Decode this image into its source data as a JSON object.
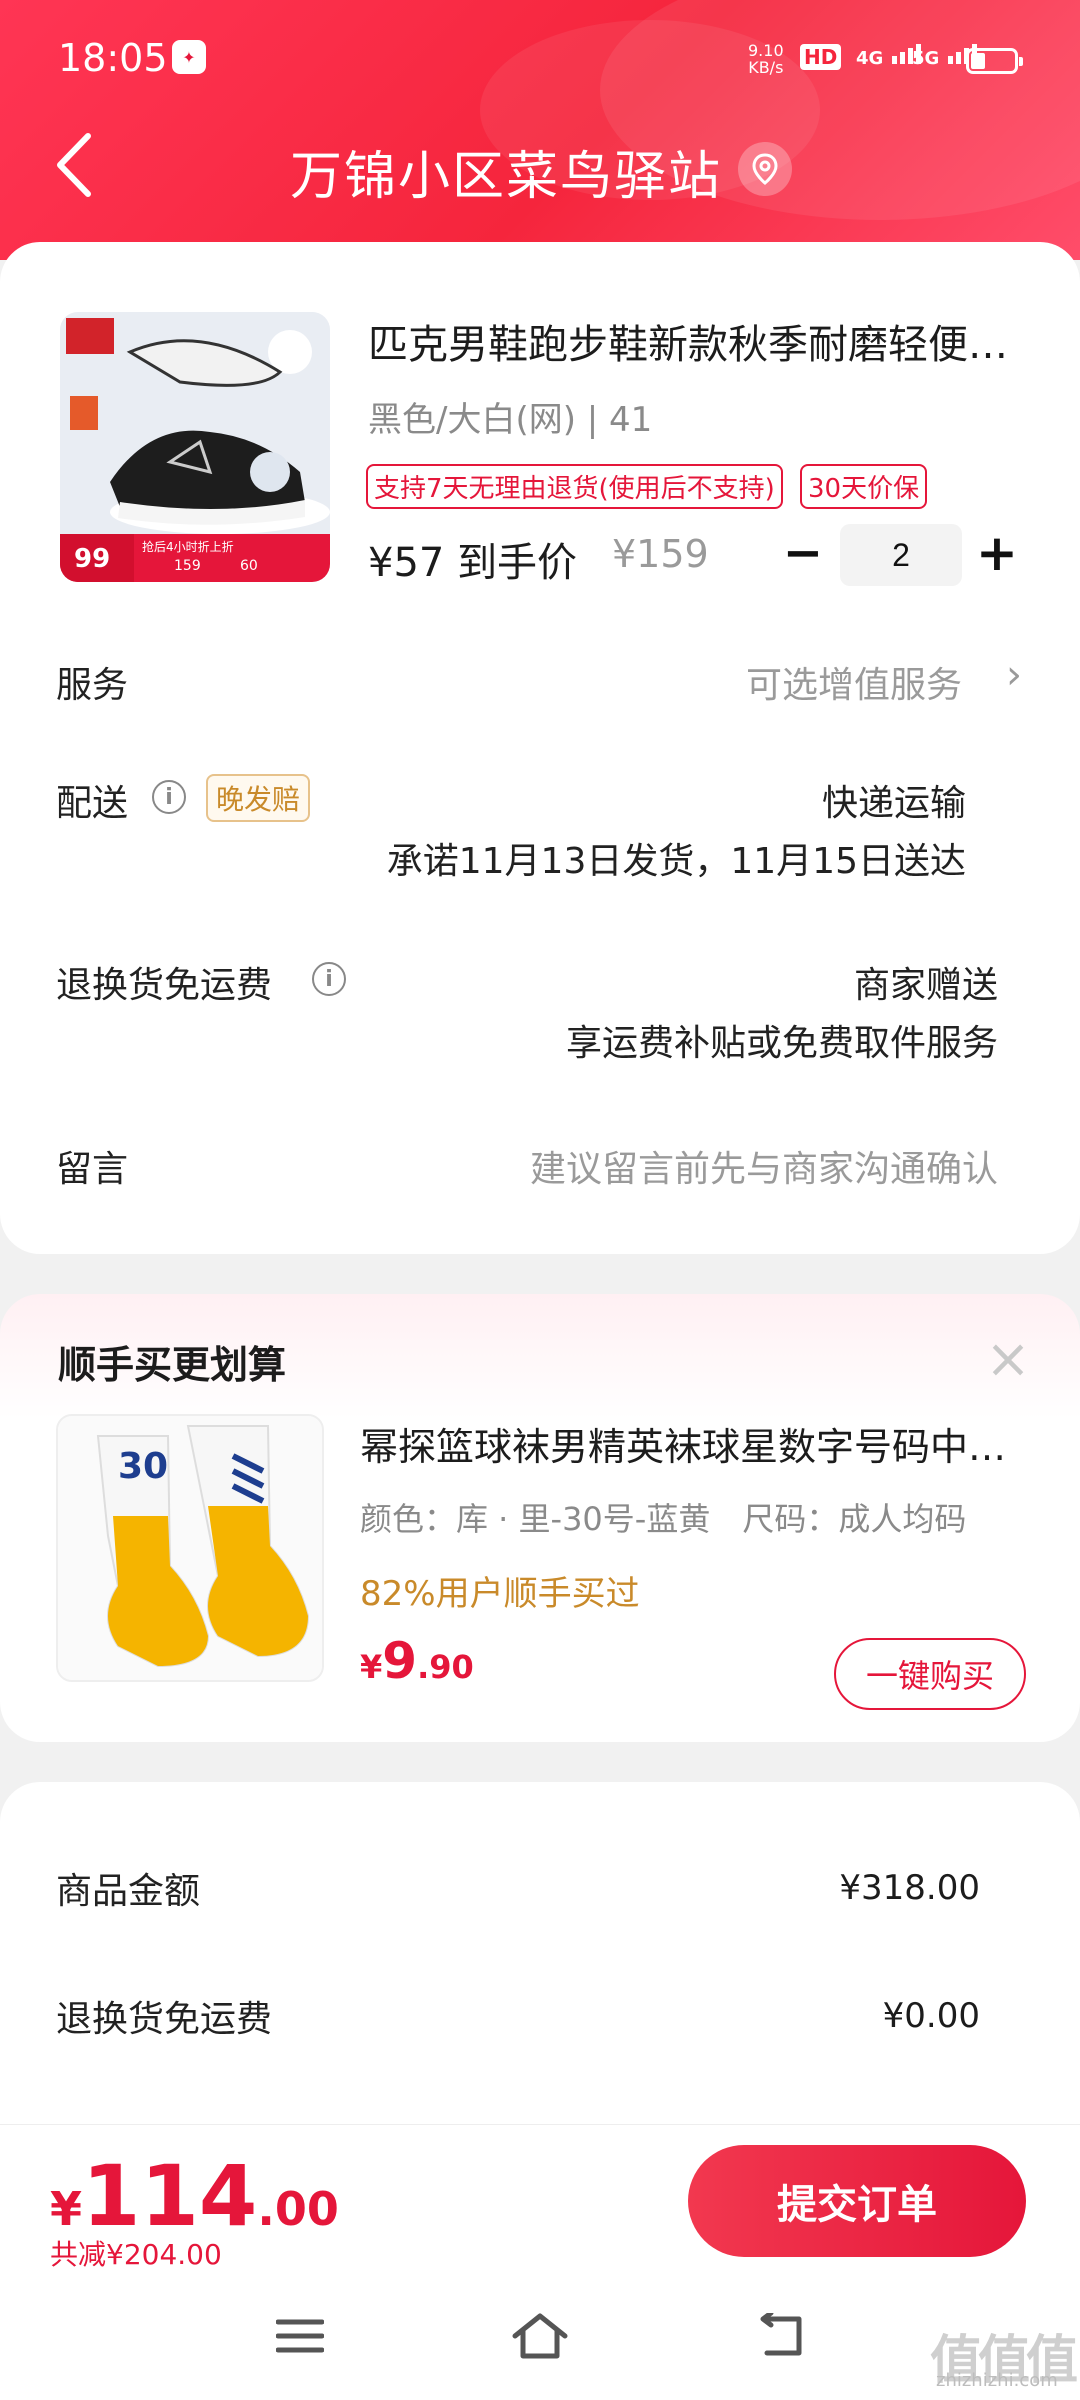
{
  "status_bar": {
    "time": "18:05",
    "app_badge": "tmall",
    "net_speed_value": "9.10",
    "net_speed_unit": "KB/s",
    "hd_label": "HD",
    "sim1": "4G",
    "sim2": "5G"
  },
  "header": {
    "title": "万锦小区菜鸟驿站",
    "back_icon": "chevron-left-icon",
    "location_icon": "location-pin-icon"
  },
  "product": {
    "title": "匹克男鞋跑步鞋新款秋季耐磨轻便运动鞋",
    "spec": "黑色/大白(网) | 41",
    "tags": [
      "支持7天无理由退货(使用后不支持)",
      "30天价保"
    ],
    "final_price": "¥57 到手价",
    "original_price": "¥159",
    "quantity": "2",
    "image_badge_price": "99",
    "image_badge_note": "抢后4小时折上折",
    "image_badge_orig": "159",
    "image_badge_coupon": "60"
  },
  "service": {
    "label": "服务",
    "value": "可选增值服务",
    "chevron": "›"
  },
  "delivery": {
    "label": "配送",
    "late_tag": "晚发赔",
    "method": "快递运输",
    "promise": "承诺11月13日发货，11月15日送达"
  },
  "return_shipping": {
    "label": "退换货免运费",
    "value_line1": "商家赠送",
    "value_line2": "享运费补贴或免费取件服务"
  },
  "message": {
    "label": "留言",
    "placeholder": "建议留言前先与商家沟通确认"
  },
  "addon": {
    "title": "顺手买更划算",
    "close": "×",
    "product_title": "幂探篮球袜男精英袜球星数字号码中筒袜",
    "spec": "颜色：库 · 里-30号-蓝黄　尺码：成人均码",
    "purchase_rate": "82%用户顺手买过",
    "price_currency": "¥",
    "price_int": "9",
    "price_dec": ".90",
    "buy_button": "一键购买",
    "sock_number": "30"
  },
  "summary": {
    "goods_amount_label": "商品金额",
    "goods_amount_value": "¥318.00",
    "return_fee_label": "退换货免运费",
    "return_fee_value": "¥0.00"
  },
  "checkout": {
    "currency": "¥",
    "total_int": "114",
    "total_dec": ".00",
    "discount": "共减¥204.00",
    "submit": "提交订单"
  },
  "watermark": {
    "main": "值值值",
    "sub": "zhizhizhi.com"
  },
  "colors": {
    "brand_red": "#e5163a",
    "header_red": "#f5253c",
    "gold": "#c98a2a"
  }
}
